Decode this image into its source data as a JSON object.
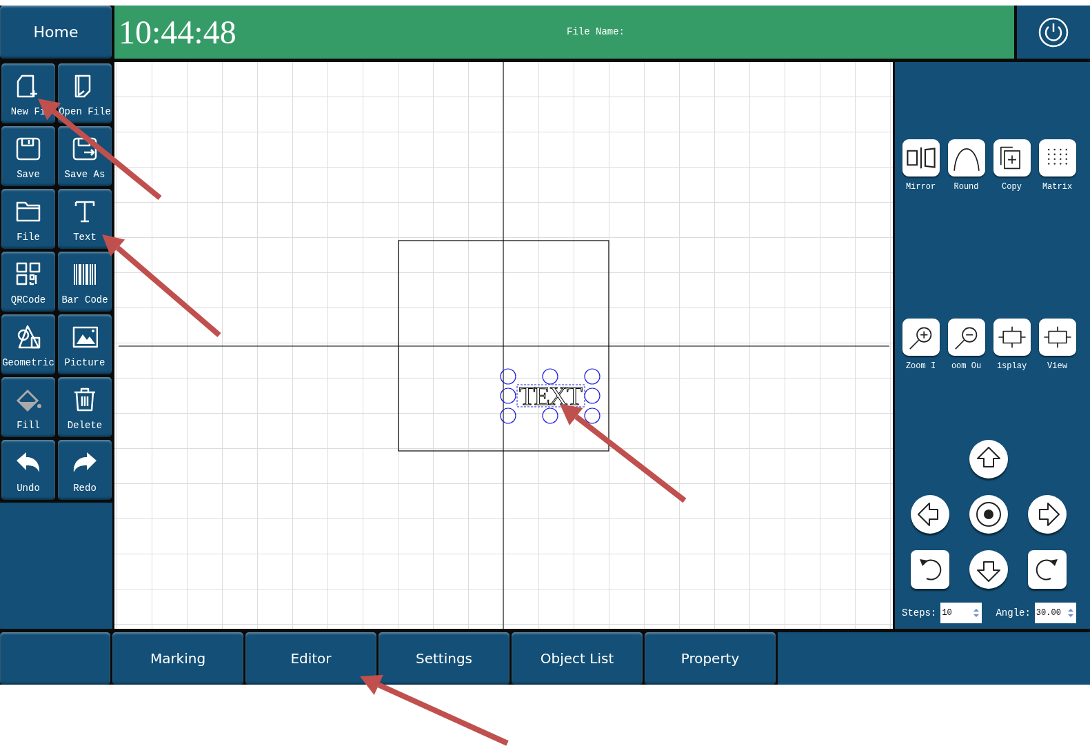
{
  "header": {
    "home": "Home",
    "time": "10:44:48",
    "file_name_label": "File Name:"
  },
  "tools": [
    {
      "kind": "new-file",
      "label": "New Fi"
    },
    {
      "kind": "open-file",
      "label": "Open File"
    },
    {
      "kind": "save",
      "label": "Save"
    },
    {
      "kind": "save-as",
      "label": "Save As"
    },
    {
      "kind": "file",
      "label": "File"
    },
    {
      "kind": "text",
      "label": "Text"
    },
    {
      "kind": "qrcode",
      "label": "QRCode"
    },
    {
      "kind": "barcode",
      "label": "Bar Code"
    },
    {
      "kind": "geometric",
      "label": "Geometric"
    },
    {
      "kind": "picture",
      "label": "Picture"
    },
    {
      "kind": "fill",
      "label": "Fill"
    },
    {
      "kind": "delete",
      "label": "Delete"
    },
    {
      "kind": "undo",
      "label": "Undo"
    },
    {
      "kind": "redo",
      "label": "Redo"
    }
  ],
  "edit_tools": [
    {
      "kind": "mirror",
      "label": "Mirror"
    },
    {
      "kind": "round",
      "label": "Round"
    },
    {
      "kind": "copy",
      "label": "Copy"
    },
    {
      "kind": "matrix",
      "label": "Matrix"
    }
  ],
  "view_tools": [
    {
      "kind": "zoom-in",
      "label": "Zoom I"
    },
    {
      "kind": "zoom-out",
      "label": "oom Ou"
    },
    {
      "kind": "frame",
      "label": "isplay"
    },
    {
      "kind": "frame",
      "label": "View"
    }
  ],
  "move_pad": [
    {
      "kind": "up"
    },
    {
      "kind": "left"
    },
    {
      "kind": "center"
    },
    {
      "kind": "right"
    },
    {
      "kind": "rotate-left"
    },
    {
      "kind": "down"
    },
    {
      "kind": "rotate-right"
    }
  ],
  "steps": {
    "label": "Steps:",
    "value": "10"
  },
  "angle": {
    "label": "Angle:",
    "value": "30.00"
  },
  "canvas": {
    "object_text": "TEXT"
  },
  "tabs": [
    {
      "label": "Marking"
    },
    {
      "label": "Editor"
    },
    {
      "label": "Settings"
    },
    {
      "label": "Object List"
    },
    {
      "label": "Property"
    }
  ]
}
